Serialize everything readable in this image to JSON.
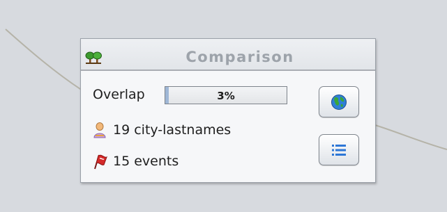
{
  "panel": {
    "title": "Comparison",
    "header_icon": "trees-icon",
    "overlap": {
      "label": "Overlap",
      "value_text": "3%",
      "fraction": 0.03
    },
    "rows": [
      {
        "icon": "person-icon",
        "text": "19 city-lastnames"
      },
      {
        "icon": "event-flag-icon",
        "text": "15 events"
      }
    ],
    "buttons": [
      {
        "icon": "globe-icon",
        "action": "map"
      },
      {
        "icon": "list-icon",
        "action": "list"
      }
    ]
  },
  "colors": {
    "background": "#d7dadf",
    "panel": "#f6f7f9",
    "title": "#9da3aa",
    "globe_ocean": "#2f7fd8",
    "globe_land": "#3aa63a",
    "list_icon": "#2d77d6",
    "flag": "#c8202a"
  }
}
